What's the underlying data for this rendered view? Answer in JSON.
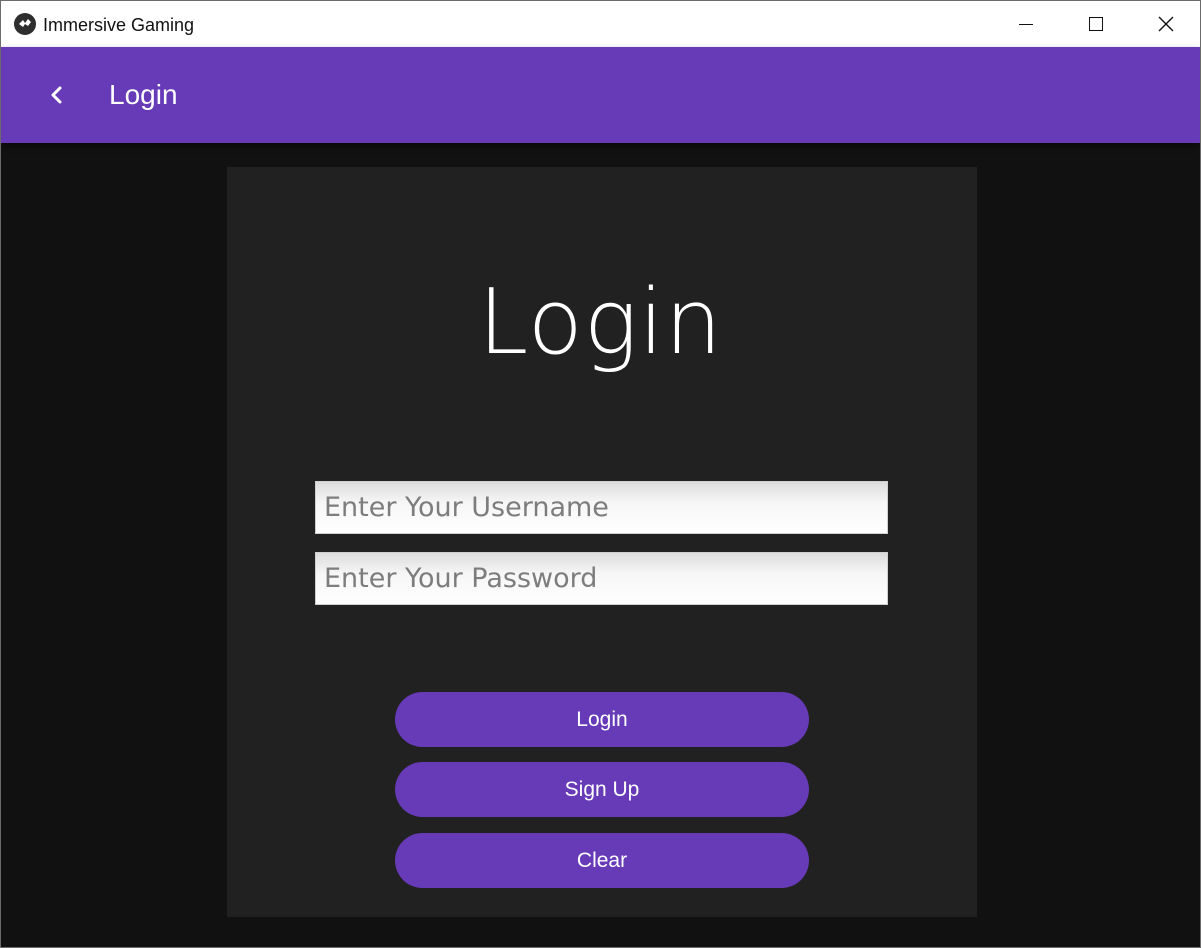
{
  "window": {
    "title": "Immersive Gaming",
    "app_icon": "kivy-logo-icon",
    "controls": [
      "minimize-icon",
      "maximize-icon",
      "close-icon"
    ]
  },
  "toolbar": {
    "back_icon": "chevron-left-icon",
    "title": "Login"
  },
  "card": {
    "heading": "Login",
    "username_placeholder": "Enter Your Username",
    "password_placeholder": "Enter Your Password",
    "login_label": "Login",
    "signup_label": "Sign Up",
    "clear_label": "Clear"
  },
  "colors": {
    "accent": "#673ab7",
    "background": "#111111",
    "card": "#212121"
  }
}
